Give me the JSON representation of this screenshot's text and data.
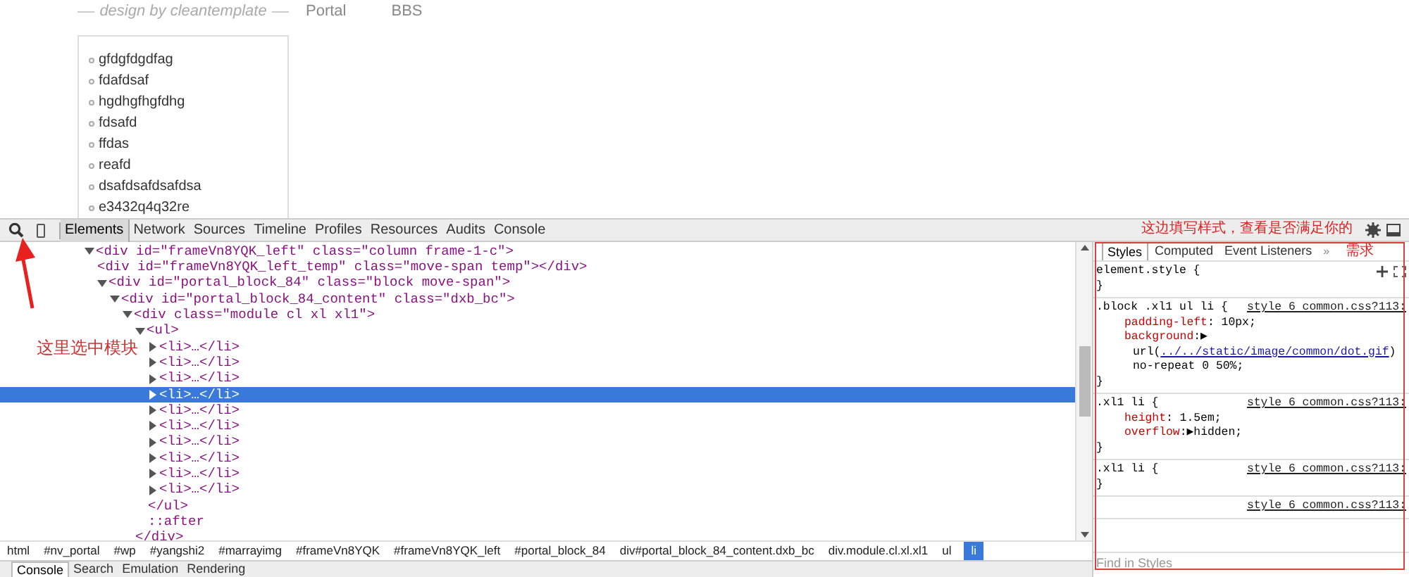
{
  "page": {
    "tagline": "design by cleantemplate",
    "nav": [
      "Portal",
      "BBS"
    ],
    "list": [
      "gfdgfdgdfag",
      "fdafdsaf",
      "hgdhgfhgfdhg",
      "fdsafd",
      "ffdas",
      "reafd",
      "dsafdsafdsafdsa",
      "e3432q4q32re"
    ]
  },
  "toolbar": {
    "tabs": [
      {
        "label": "Elements",
        "selected": true
      },
      {
        "label": "Network",
        "selected": false
      },
      {
        "label": "Sources",
        "selected": false
      },
      {
        "label": "Timeline",
        "selected": false
      },
      {
        "label": "Profiles",
        "selected": false
      },
      {
        "label": "Resources",
        "selected": false
      },
      {
        "label": "Audits",
        "selected": false
      },
      {
        "label": "Console",
        "selected": false
      }
    ]
  },
  "tree": [
    {
      "kind": "tag",
      "text": "<div id=\"frameVn8YQK_left\" class=\"column frame-1-c\">",
      "expanded": true,
      "selected": false,
      "children": [
        {
          "kind": "plain",
          "text": "<div id=\"frameVn8YQK_left_temp\" class=\"move-span temp\"></div>",
          "selected": false
        },
        {
          "kind": "tag",
          "text": "<div id=\"portal_block_84\" class=\"block move-span\">",
          "expanded": true,
          "selected": false,
          "children": [
            {
              "kind": "tag",
              "text": "<div id=\"portal_block_84_content\" class=\"dxb_bc\">",
              "expanded": true,
              "selected": false,
              "children": [
                {
                  "kind": "tag",
                  "text": "<div class=\"module cl xl xl1\">",
                  "expanded": true,
                  "selected": false,
                  "children": [
                    {
                      "kind": "tag",
                      "text": "<ul>",
                      "expanded": true,
                      "selected": false,
                      "children": [
                        {
                          "kind": "tag",
                          "text": "<li>…</li>",
                          "expanded": false,
                          "selected": false
                        },
                        {
                          "kind": "tag",
                          "text": "<li>…</li>",
                          "expanded": false,
                          "selected": false
                        },
                        {
                          "kind": "tag",
                          "text": "<li>…</li>",
                          "expanded": false,
                          "selected": false
                        },
                        {
                          "kind": "tag",
                          "text": "<li>…</li>",
                          "expanded": false,
                          "selected": true
                        },
                        {
                          "kind": "tag",
                          "text": "<li>…</li>",
                          "expanded": false,
                          "selected": false
                        },
                        {
                          "kind": "tag",
                          "text": "<li>…</li>",
                          "expanded": false,
                          "selected": false
                        },
                        {
                          "kind": "tag",
                          "text": "<li>…</li>",
                          "expanded": false,
                          "selected": false
                        },
                        {
                          "kind": "tag",
                          "text": "<li>…</li>",
                          "expanded": false,
                          "selected": false
                        },
                        {
                          "kind": "tag",
                          "text": "<li>…</li>",
                          "expanded": false,
                          "selected": false
                        },
                        {
                          "kind": "tag",
                          "text": "<li>…</li>",
                          "expanded": false,
                          "selected": false
                        },
                        {
                          "kind": "plain",
                          "text": "</ul>",
                          "selected": false
                        },
                        {
                          "kind": "plain",
                          "text": "::after",
                          "selected": false
                        }
                      ]
                    },
                    {
                      "kind": "plain",
                      "text": "</div>",
                      "selected": false
                    }
                  ]
                }
              ]
            }
          ]
        }
      ]
    }
  ],
  "breadcrumbs": [
    {
      "label": "html",
      "selected": false
    },
    {
      "label": "#nv_portal",
      "selected": false
    },
    {
      "label": "#wp",
      "selected": false
    },
    {
      "label": "#yangshi2",
      "selected": false
    },
    {
      "label": "#marrayimg",
      "selected": false
    },
    {
      "label": "#frameVn8YQK",
      "selected": false
    },
    {
      "label": "#frameVn8YQK_left",
      "selected": false
    },
    {
      "label": "#portal_block_84",
      "selected": false
    },
    {
      "label": "div#portal_block_84_content.dxb_bc",
      "selected": false
    },
    {
      "label": "div.module.cl.xl.xl1",
      "selected": false
    },
    {
      "label": "ul",
      "selected": false
    },
    {
      "label": "li",
      "selected": true
    }
  ],
  "drawer_tabs": [
    {
      "label": "Console",
      "selected": true
    },
    {
      "label": "Search",
      "selected": false
    },
    {
      "label": "Emulation",
      "selected": false
    },
    {
      "label": "Rendering",
      "selected": false
    }
  ],
  "styles": {
    "tabs": [
      {
        "label": "Styles",
        "selected": true
      },
      {
        "label": "Computed",
        "selected": false
      },
      {
        "label": "Event Listeners",
        "selected": false
      }
    ],
    "more": "»",
    "rules": [
      {
        "selector": "element.style {",
        "close": "}"
      },
      {
        "selector": ".block .xl1 ul li {",
        "source": "style 6 common.css?113:",
        "props": [
          {
            "kind": "prop",
            "name": "padding-left",
            "value": ": 10px;"
          },
          {
            "kind": "prop",
            "name": "background",
            "value": ":▶"
          },
          {
            "kind": "url",
            "prefix": "url(",
            "link": "../../static/image/common/dot.gif",
            "suffix": ")"
          },
          {
            "kind": "cont",
            "value": "no-repeat 0 50%;"
          }
        ],
        "close": "}"
      },
      {
        "selector": ".xl1 li {",
        "source": "style 6 common.css?113:",
        "props": [
          {
            "kind": "prop",
            "name": "height",
            "value": ": 1.5em;"
          },
          {
            "kind": "prop",
            "name": "overflow",
            "value": ":▶hidden;"
          }
        ],
        "close": "}"
      },
      {
        "selector": ".xl1 li {",
        "source": "style 6 common.css?113:",
        "close": "}"
      },
      {
        "source": "style 6 common.css?113:"
      }
    ],
    "filter_placeholder": "Find in Styles"
  },
  "annotations": {
    "styles_note": "这边填写样式，查看是否满足你的",
    "styles_note_2": "需求",
    "select_note": "这里选中模块"
  }
}
